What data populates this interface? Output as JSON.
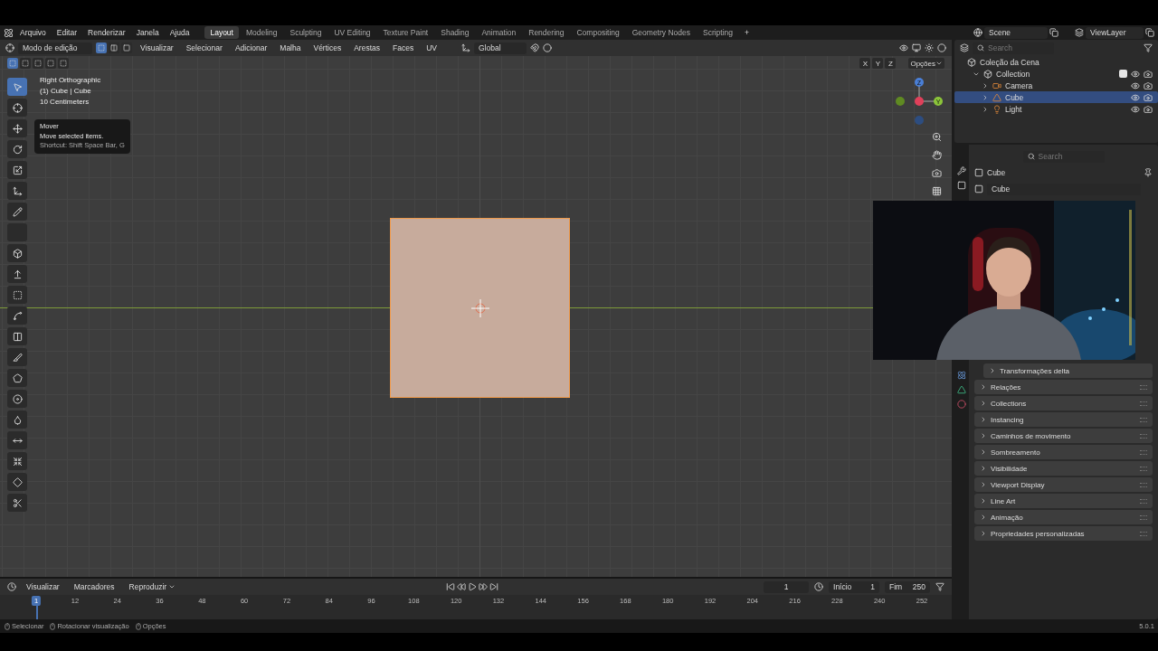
{
  "menu_bar": {
    "menus": [
      "Arquivo",
      "Editar",
      "Renderizar",
      "Janela",
      "Ajuda"
    ],
    "workspaces": [
      {
        "label": "Layout",
        "selected": true
      },
      {
        "label": "Modeling",
        "selected": false
      },
      {
        "label": "Sculpting",
        "selected": false
      },
      {
        "label": "UV Editing",
        "selected": false
      },
      {
        "label": "Texture Paint",
        "selected": false
      },
      {
        "label": "Shading",
        "selected": false
      },
      {
        "label": "Animation",
        "selected": false
      },
      {
        "label": "Rendering",
        "selected": false
      },
      {
        "label": "Compositing",
        "selected": false
      },
      {
        "label": "Geometry Nodes",
        "selected": false
      },
      {
        "label": "Scripting",
        "selected": false
      }
    ],
    "add_tab": "+",
    "scene": "Scene",
    "view_layer": "ViewLayer"
  },
  "viewport": {
    "mode": "Modo de edição",
    "select_modes": [
      {
        "kind": "vertex",
        "selected": true
      },
      {
        "kind": "edge",
        "selected": false
      },
      {
        "kind": "face",
        "selected": false
      }
    ],
    "menus": [
      "Visualizar",
      "Selecionar",
      "Adicionar",
      "Malha",
      "Vértices",
      "Arestas",
      "Faces",
      "UV"
    ],
    "orientation": "Global",
    "axes": [
      "X",
      "Y",
      "Z"
    ],
    "options": "Opções",
    "overlay_info": [
      "Right Orthographic",
      "(1) Cube | Cube",
      "10 Centimeters"
    ],
    "gizmo_labels": [
      "Z",
      "Y"
    ],
    "tools": [
      {
        "kind": "select",
        "selected": true
      },
      {
        "kind": "cursor",
        "selected": false
      },
      {
        "kind": "move",
        "selected": false
      },
      {
        "kind": "rotate",
        "selected": false
      },
      {
        "kind": "scale",
        "selected": false
      },
      {
        "kind": "transform",
        "selected": false
      },
      {
        "kind": "annotate",
        "selected": false
      },
      {
        "kind": "measure",
        "selected": false
      },
      {
        "kind": "add-cube",
        "selected": false
      },
      {
        "kind": "extrude",
        "selected": false
      },
      {
        "kind": "inset",
        "selected": false
      },
      {
        "kind": "bevel",
        "selected": false
      },
      {
        "kind": "loop-cut",
        "selected": false
      },
      {
        "kind": "knife",
        "selected": false
      },
      {
        "kind": "poly-build",
        "selected": false
      },
      {
        "kind": "spin",
        "selected": false
      },
      {
        "kind": "smooth",
        "selected": false
      },
      {
        "kind": "edge-slide",
        "selected": false
      },
      {
        "kind": "shrink",
        "selected": false
      },
      {
        "kind": "shear",
        "selected": false
      },
      {
        "kind": "rip",
        "selected": false
      }
    ],
    "tooltip": {
      "title": "Mover",
      "description": "Move selected items.",
      "shortcut": "Shortcut: Shift Space Bar, G"
    }
  },
  "outliner": {
    "search": {
      "placeholder": "Search"
    },
    "scene_collection": "Coleção da Cena",
    "collection": {
      "name": "Collection",
      "checked": true,
      "children": [
        {
          "name": "Camera",
          "kind": "camera",
          "selected": false
        },
        {
          "name": "Cube",
          "kind": "mesh",
          "selected": true
        },
        {
          "name": "Light",
          "kind": "light",
          "selected": false
        }
      ]
    }
  },
  "properties": {
    "search": {
      "placeholder": "Search"
    },
    "object_name": "Cube",
    "data_name": "Cube",
    "subpanel": {
      "label": "Transformações delta",
      "expanded": false
    },
    "panels": [
      {
        "label": "Relações",
        "expanded": false
      },
      {
        "label": "Collections",
        "expanded": false
      },
      {
        "label": "Instancing",
        "expanded": false
      },
      {
        "label": "Caminhos de movimento",
        "expanded": false
      },
      {
        "label": "Sombreamento",
        "expanded": false
      },
      {
        "label": "Visibilidade",
        "expanded": false
      },
      {
        "label": "Viewport Display",
        "expanded": false
      },
      {
        "label": "Line Art",
        "expanded": false
      },
      {
        "label": "Animação",
        "expanded": false
      },
      {
        "label": "Propriedades personalizadas",
        "expanded": false
      }
    ]
  },
  "timeline": {
    "menus": [
      "Visualizar",
      "Marcadores"
    ],
    "playback": "Reproduzir",
    "current_frame": "1",
    "start_label": "Início",
    "start": "1",
    "end_label": "Fim",
    "end": "250",
    "ruler": [
      "1",
      "12",
      "24",
      "36",
      "48",
      "60",
      "72",
      "84",
      "96",
      "108",
      "120",
      "132",
      "144",
      "156",
      "168",
      "180",
      "192",
      "204",
      "216",
      "228",
      "240",
      "252"
    ]
  },
  "status_bar": {
    "hints": [
      "Selecionar",
      "Rotacionar visualização",
      "Opções"
    ],
    "version": "5.0.1"
  }
}
